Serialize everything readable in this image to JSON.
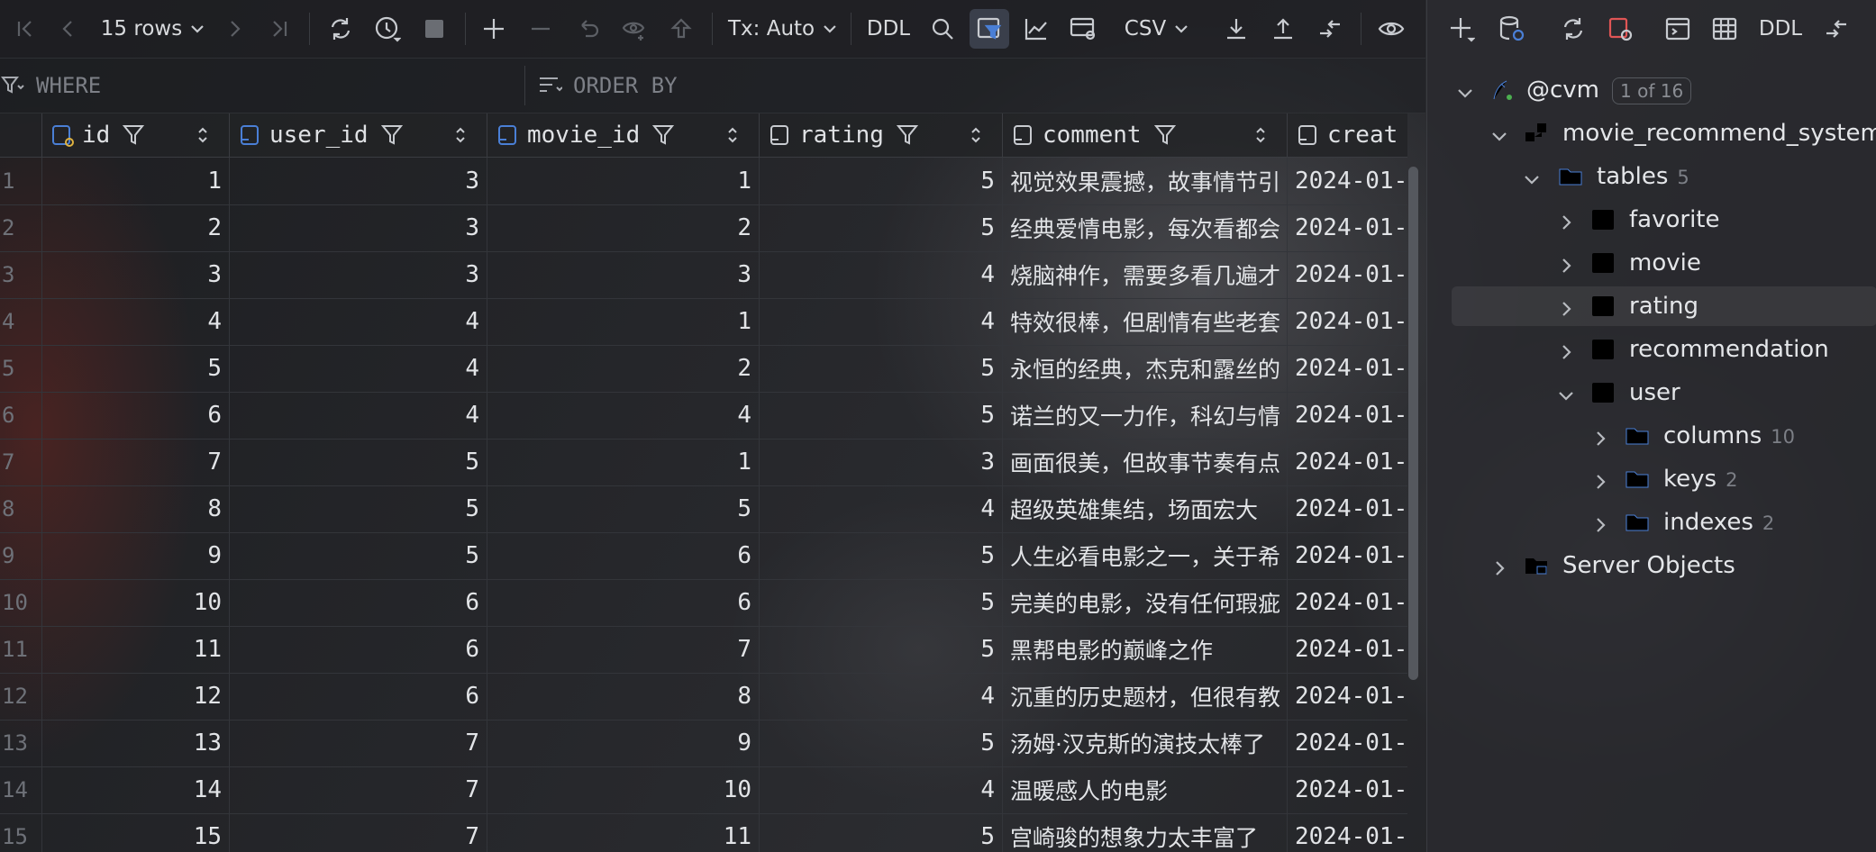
{
  "toolbar": {
    "rows_label": "15 rows",
    "tx_label": "Tx: Auto",
    "ddl_label": "DDL",
    "csv_label": "CSV"
  },
  "filter": {
    "where_placeholder": "WHERE",
    "order_placeholder": "ORDER BY"
  },
  "columns": [
    {
      "name": "id"
    },
    {
      "name": "user_id"
    },
    {
      "name": "movie_id"
    },
    {
      "name": "rating"
    },
    {
      "name": "comment"
    },
    {
      "name": "creat"
    }
  ],
  "rows": [
    {
      "rn": "1",
      "id": "1",
      "user_id": "3",
      "movie_id": "1",
      "rating": "5",
      "comment": "视觉效果震撼，故事情节引",
      "created": "2024-01-"
    },
    {
      "rn": "2",
      "id": "2",
      "user_id": "3",
      "movie_id": "2",
      "rating": "5",
      "comment": "经典爱情电影，每次看都会",
      "created": "2024-01-"
    },
    {
      "rn": "3",
      "id": "3",
      "user_id": "3",
      "movie_id": "3",
      "rating": "4",
      "comment": "烧脑神作，需要多看几遍才",
      "created": "2024-01-"
    },
    {
      "rn": "4",
      "id": "4",
      "user_id": "4",
      "movie_id": "1",
      "rating": "4",
      "comment": "特效很棒，但剧情有些老套",
      "created": "2024-01-"
    },
    {
      "rn": "5",
      "id": "5",
      "user_id": "4",
      "movie_id": "2",
      "rating": "5",
      "comment": "永恒的经典，杰克和露丝的",
      "created": "2024-01-"
    },
    {
      "rn": "6",
      "id": "6",
      "user_id": "4",
      "movie_id": "4",
      "rating": "5",
      "comment": "诺兰的又一力作，科幻与情",
      "created": "2024-01-"
    },
    {
      "rn": "7",
      "id": "7",
      "user_id": "5",
      "movie_id": "1",
      "rating": "3",
      "comment": "画面很美，但故事节奏有点",
      "created": "2024-01-"
    },
    {
      "rn": "8",
      "id": "8",
      "user_id": "5",
      "movie_id": "5",
      "rating": "4",
      "comment": "超级英雄集结，场面宏大",
      "created": "2024-01-"
    },
    {
      "rn": "9",
      "id": "9",
      "user_id": "5",
      "movie_id": "6",
      "rating": "5",
      "comment": "人生必看电影之一，关于希",
      "created": "2024-01-"
    },
    {
      "rn": "10",
      "id": "10",
      "user_id": "6",
      "movie_id": "6",
      "rating": "5",
      "comment": "完美的电影，没有任何瑕疵",
      "created": "2024-01-"
    },
    {
      "rn": "11",
      "id": "11",
      "user_id": "6",
      "movie_id": "7",
      "rating": "5",
      "comment": "黑帮电影的巅峰之作",
      "created": "2024-01-"
    },
    {
      "rn": "12",
      "id": "12",
      "user_id": "6",
      "movie_id": "8",
      "rating": "4",
      "comment": "沉重的历史题材，但很有教",
      "created": "2024-01-"
    },
    {
      "rn": "13",
      "id": "13",
      "user_id": "7",
      "movie_id": "9",
      "rating": "5",
      "comment": "汤姆·汉克斯的演技太棒了",
      "created": "2024-01-"
    },
    {
      "rn": "14",
      "id": "14",
      "user_id": "7",
      "movie_id": "10",
      "rating": "4",
      "comment": "温暖感人的电影",
      "created": "2024-01-"
    },
    {
      "rn": "15",
      "id": "15",
      "user_id": "7",
      "movie_id": "11",
      "rating": "5",
      "comment": "宫崎骏的想象力太丰富了",
      "created": "2024-01-"
    }
  ],
  "right_toolbar": {
    "ddl_label": "DDL"
  },
  "tree": {
    "connection": "@cvm",
    "connection_badge": "1 of 16",
    "schema": "movie_recommend_system",
    "tables_label": "tables",
    "tables_count": "5",
    "tables": [
      "favorite",
      "movie",
      "rating",
      "recommendation",
      "user"
    ],
    "user_children": [
      {
        "label": "columns",
        "count": "10"
      },
      {
        "label": "keys",
        "count": "2"
      },
      {
        "label": "indexes",
        "count": "2"
      }
    ],
    "server_objects": "Server Objects"
  },
  "colors": {
    "accent": "#4a7fd6",
    "selected_bg": "#3a3f4b"
  }
}
